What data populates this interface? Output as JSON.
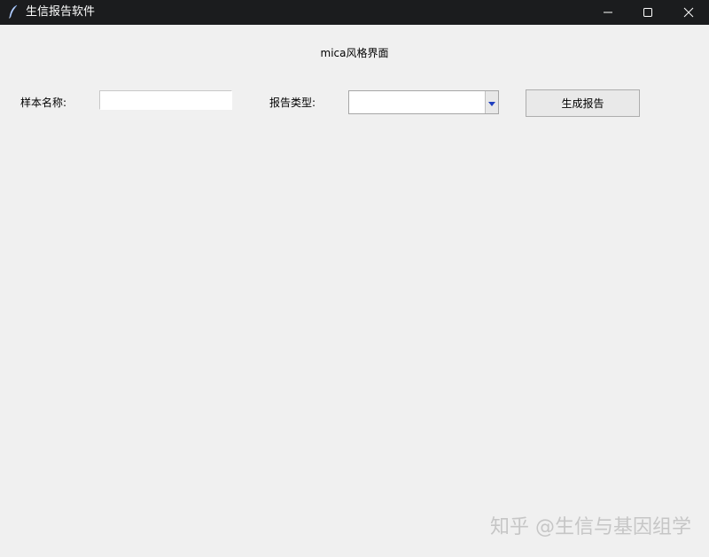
{
  "window": {
    "title": "生信报告软件",
    "controls": {
      "minimize_icon": "minimize-icon",
      "maximize_icon": "maximize-icon",
      "close_icon": "close-icon"
    }
  },
  "main": {
    "heading": "mica风格界面",
    "sample_name": {
      "label": "样本名称:",
      "value": "",
      "placeholder": ""
    },
    "report_type": {
      "label": "报告类型:",
      "selected": ""
    },
    "generate_button": {
      "label": "生成报告"
    }
  },
  "watermark": "知乎 @生信与基因组学",
  "colors": {
    "titlebar_bg": "#1b1c1e",
    "window_bg": "#f0f0f0",
    "combo_arrow": "#1f3fbf"
  }
}
